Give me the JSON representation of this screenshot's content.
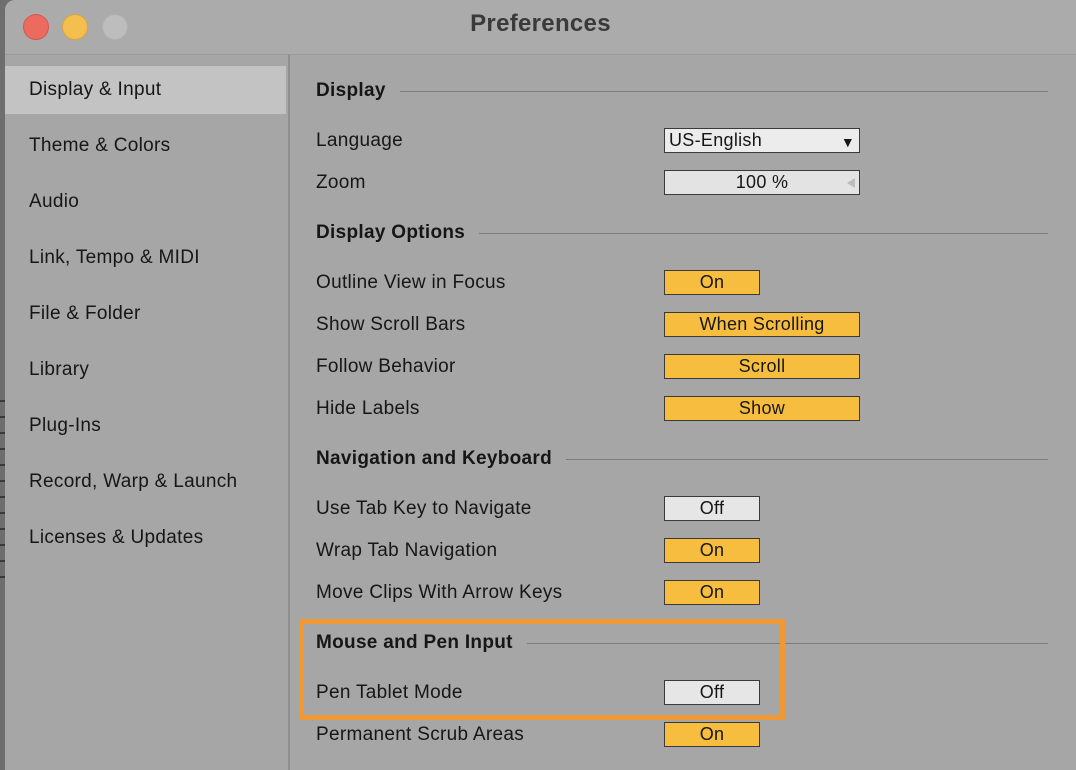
{
  "window": {
    "title": "Preferences"
  },
  "sidebar": {
    "items": [
      {
        "label": "Display & Input",
        "selected": true
      },
      {
        "label": "Theme & Colors",
        "selected": false
      },
      {
        "label": "Audio",
        "selected": false
      },
      {
        "label": "Link, Tempo & MIDI",
        "selected": false
      },
      {
        "label": "File & Folder",
        "selected": false
      },
      {
        "label": "Library",
        "selected": false
      },
      {
        "label": "Plug-Ins",
        "selected": false
      },
      {
        "label": "Record, Warp & Launch",
        "selected": false
      },
      {
        "label": "Licenses & Updates",
        "selected": false
      }
    ]
  },
  "sections": {
    "display": {
      "title": "Display",
      "language": {
        "label": "Language",
        "value": "US-English"
      },
      "zoom": {
        "label": "Zoom",
        "value": "100 %"
      }
    },
    "display_options": {
      "title": "Display Options",
      "outline_view": {
        "label": "Outline View in Focus",
        "value": "On"
      },
      "scroll_bars": {
        "label": "Show Scroll Bars",
        "value": "When Scrolling"
      },
      "follow": {
        "label": "Follow Behavior",
        "value": "Scroll"
      },
      "hide_labels": {
        "label": "Hide Labels",
        "value": "Show"
      }
    },
    "navigation": {
      "title": "Navigation and Keyboard",
      "tab_key": {
        "label": "Use Tab Key to Navigate",
        "value": "Off"
      },
      "wrap_tab": {
        "label": "Wrap Tab Navigation",
        "value": "On"
      },
      "move_clips": {
        "label": "Move Clips With Arrow Keys",
        "value": "On"
      }
    },
    "mouse_pen": {
      "title": "Mouse and Pen Input",
      "pen_tablet": {
        "label": "Pen Tablet Mode",
        "value": "Off"
      },
      "scrub_areas": {
        "label": "Permanent Scrub Areas",
        "value": "On"
      }
    }
  },
  "colors": {
    "toggle_on": "#f7bd3f",
    "toggle_off": "#e6e6e6",
    "highlight": "#ef9834",
    "selected_item": "#c3c3c3"
  }
}
